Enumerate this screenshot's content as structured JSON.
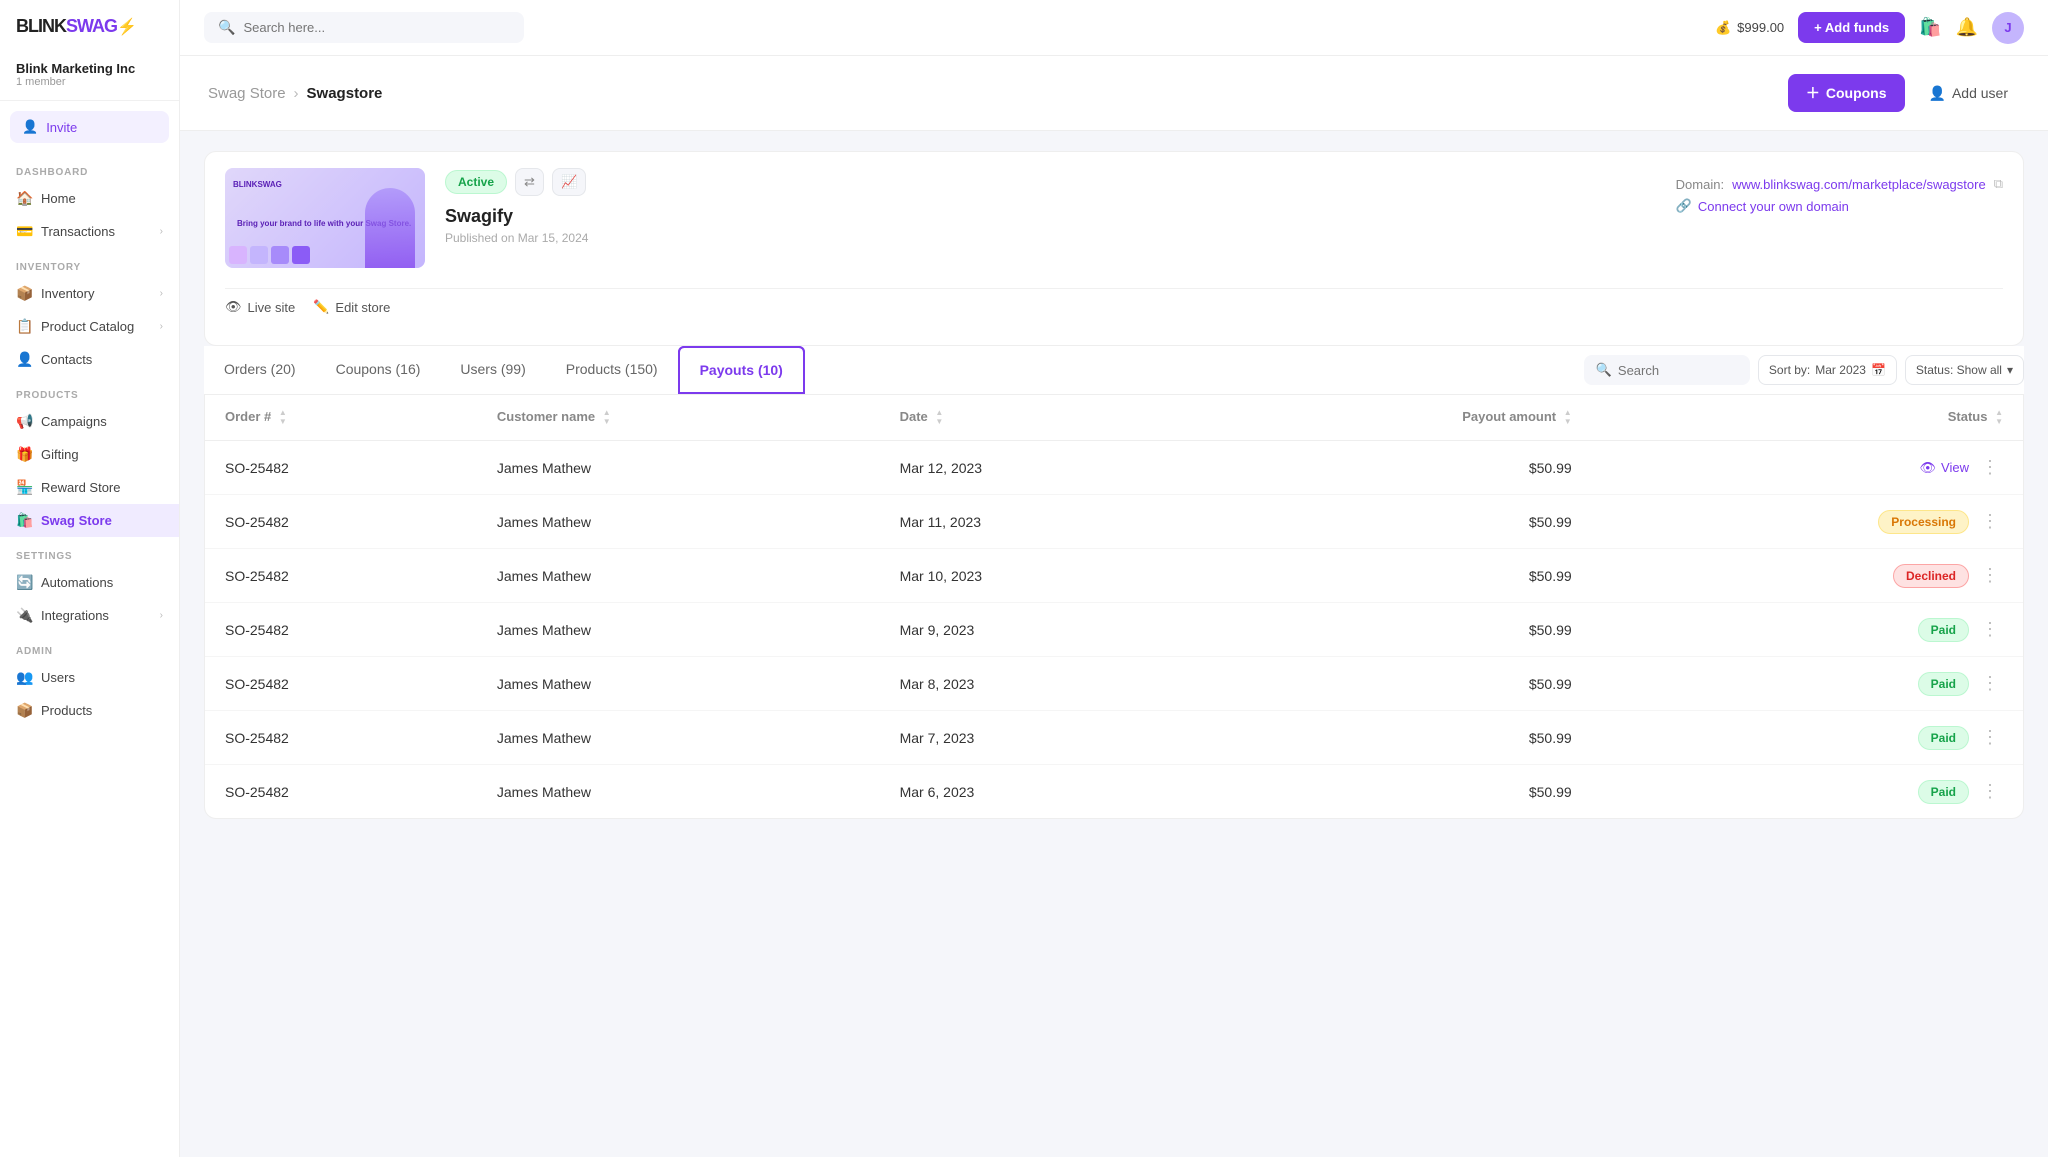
{
  "logo": {
    "text": "BLINK",
    "accent": "SWAG",
    "icon": "⚡"
  },
  "org": {
    "name": "Blink Marketing Inc",
    "member_count": "1 member"
  },
  "invite_button": "Invite",
  "sidebar": {
    "dashboard_label": "DASHBOARD",
    "items_dashboard": [
      {
        "id": "home",
        "label": "Home",
        "icon": "🏠",
        "has_chevron": false
      },
      {
        "id": "transactions",
        "label": "Transactions",
        "icon": "💳",
        "has_chevron": true
      }
    ],
    "items_inventory": [
      {
        "id": "inventory",
        "label": "Inventory",
        "icon": "📦",
        "has_chevron": true
      },
      {
        "id": "product-catalog",
        "label": "Product Catalog",
        "icon": "📋",
        "has_chevron": true
      },
      {
        "id": "contacts",
        "label": "Contacts",
        "icon": "👤",
        "has_chevron": false
      }
    ],
    "products_label": "PRODUCTS",
    "items_products": [
      {
        "id": "campaigns",
        "label": "Campaigns",
        "icon": "📢",
        "has_chevron": false
      },
      {
        "id": "gifting",
        "label": "Gifting",
        "icon": "🎁",
        "has_chevron": false
      },
      {
        "id": "reward-store",
        "label": "Reward Store",
        "icon": "🏪",
        "has_chevron": false
      },
      {
        "id": "swag-store",
        "label": "Swag Store",
        "icon": "🛍️",
        "has_chevron": false,
        "active": true
      }
    ],
    "settings_label": "SETTINGS",
    "items_settings": [
      {
        "id": "automations",
        "label": "Automations",
        "icon": "🔄",
        "has_chevron": false
      },
      {
        "id": "integrations",
        "label": "Integrations",
        "icon": "🔌",
        "has_chevron": true
      }
    ],
    "admin_label": "ADMIN",
    "items_admin": [
      {
        "id": "users",
        "label": "Users",
        "icon": "👥",
        "has_chevron": false
      },
      {
        "id": "products",
        "label": "Products",
        "icon": "📦",
        "has_chevron": false
      }
    ]
  },
  "topbar": {
    "search_placeholder": "Search here...",
    "balance": "$999.00",
    "add_funds_label": "+ Add funds",
    "balance_icon": "💰"
  },
  "breadcrumb": {
    "parent": "Swag Store",
    "current": "Swagstore"
  },
  "page_actions": {
    "coupons_label": "+ Coupons",
    "add_user_label": "Add user"
  },
  "store_card": {
    "badge_active": "Active",
    "name": "Swagify",
    "published": "Published on Mar 15, 2024",
    "domain_label": "Domain:",
    "domain_url": "www.blinkswag.com/marketplace/swagstore",
    "connect_domain": "Connect your own domain",
    "live_site": "Live site",
    "edit_store": "Edit store",
    "preview_text": "Bring your brand to life with your Swag Store."
  },
  "tabs": [
    {
      "id": "orders",
      "label": "Orders (20)",
      "active": false
    },
    {
      "id": "coupons",
      "label": "Coupons (16)",
      "active": false
    },
    {
      "id": "users",
      "label": "Users (99)",
      "active": false
    },
    {
      "id": "products",
      "label": "Products (150)",
      "active": false
    },
    {
      "id": "payouts",
      "label": "Payouts (10)",
      "active": true
    }
  ],
  "table_controls": {
    "search_placeholder": "Search",
    "sort_label": "Sort by:",
    "sort_value": "Mar 2023",
    "status_label": "Status: Show all"
  },
  "table": {
    "columns": [
      "Order #",
      "Customer name",
      "Date",
      "Payout amount",
      "Status"
    ],
    "rows": [
      {
        "order": "SO-25482",
        "customer": "James Mathew",
        "date": "Mar 12, 2023",
        "amount": "$50.99",
        "status": "view"
      },
      {
        "order": "SO-25482",
        "customer": "James Mathew",
        "date": "Mar 11, 2023",
        "amount": "$50.99",
        "status": "processing"
      },
      {
        "order": "SO-25482",
        "customer": "James Mathew",
        "date": "Mar 10, 2023",
        "amount": "$50.99",
        "status": "declined"
      },
      {
        "order": "SO-25482",
        "customer": "James Mathew",
        "date": "Mar 9, 2023",
        "amount": "$50.99",
        "status": "paid"
      },
      {
        "order": "SO-25482",
        "customer": "James Mathew",
        "date": "Mar 8, 2023",
        "amount": "$50.99",
        "status": "paid"
      },
      {
        "order": "SO-25482",
        "customer": "James Mathew",
        "date": "Mar 7, 2023",
        "amount": "$50.99",
        "status": "paid"
      },
      {
        "order": "SO-25482",
        "customer": "James Mathew",
        "date": "Mar 6, 2023",
        "amount": "$50.99",
        "status": "paid"
      }
    ],
    "status_labels": {
      "view": "View",
      "processing": "Processing",
      "declined": "Declined",
      "paid": "Paid"
    }
  },
  "colors": {
    "accent": "#7c3aed",
    "active_green": "#16a34a",
    "processing_orange": "#d97706",
    "declined_red": "#dc2626"
  }
}
